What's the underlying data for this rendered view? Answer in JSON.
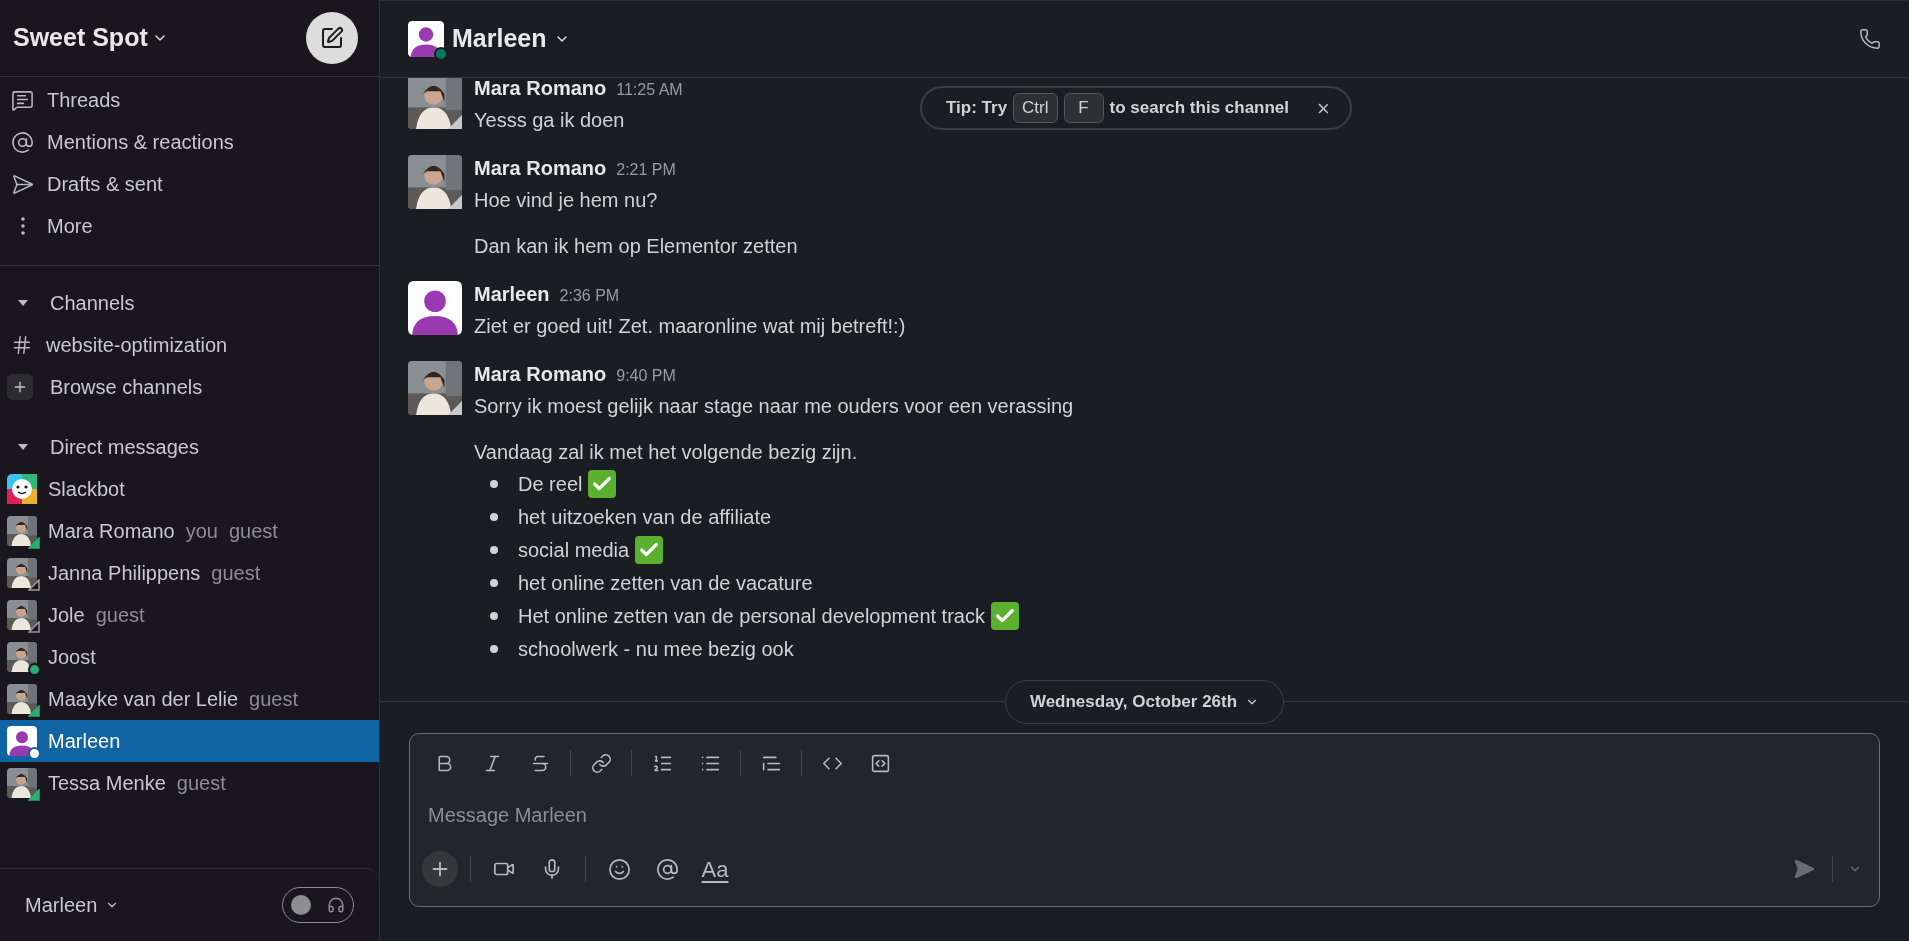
{
  "workspace": {
    "name": "Sweet Spot"
  },
  "nav": [
    {
      "kind": "threads",
      "label": "Threads"
    },
    {
      "kind": "mentions",
      "label": "Mentions & reactions"
    },
    {
      "kind": "drafts",
      "label": "Drafts & sent"
    },
    {
      "kind": "more",
      "label": "More"
    }
  ],
  "channels": {
    "title": "Channels",
    "expanded": true,
    "items": [
      {
        "kind": "channel",
        "label": "website-optimization"
      },
      {
        "kind": "browse",
        "label": "Browse channels"
      }
    ]
  },
  "direct_messages": {
    "title": "Direct messages",
    "expanded": true,
    "items": [
      {
        "name": "Slackbot",
        "kind": "bot",
        "selected": false
      },
      {
        "name": "Mara Romano",
        "tags": [
          "you",
          "guest"
        ],
        "kind": "guest",
        "online": true,
        "selected": false
      },
      {
        "name": "Janna Philippens",
        "tags": [
          "guest"
        ],
        "kind": "guest",
        "online": false,
        "selected": false
      },
      {
        "name": "Jole",
        "tags": [
          "guest"
        ],
        "kind": "guest",
        "online": false,
        "selected": false
      },
      {
        "name": "Joost",
        "kind": "member",
        "online": true,
        "selected": false
      },
      {
        "name": "Maayke van der Lelie",
        "tags": [
          "guest"
        ],
        "kind": "guest",
        "online": true,
        "selected": false
      },
      {
        "name": "Marleen",
        "kind": "default",
        "online": true,
        "selected": true
      },
      {
        "name": "Tessa Menke",
        "tags": [
          "guest"
        ],
        "kind": "guest",
        "online": true,
        "selected": false
      }
    ]
  },
  "footer": {
    "user": "Marleen",
    "huddle_on": false
  },
  "header": {
    "title": "Marleen",
    "online": true
  },
  "tip": {
    "prefix": "Tip: Try",
    "keys": [
      "Ctrl",
      "F"
    ],
    "suffix": "to search this channel",
    "close": "×"
  },
  "messages": [
    {
      "author": "Mara Romano",
      "time": "11:25 AM",
      "lines": [
        "Yesss ga ik doen"
      ]
    },
    {
      "author": "Mara Romano",
      "time": "2:21 PM",
      "lines": [
        "Hoe vind je hem nu?",
        "Dan kan ik hem op Elementor zetten"
      ]
    },
    {
      "author": "Marleen",
      "kind": "default",
      "time": "2:36 PM",
      "lines": [
        "Ziet er goed uit! Zet. maaronline wat mij betreft!:)"
      ]
    },
    {
      "author": "Mara Romano",
      "time": "9:40 PM",
      "lines": [
        "Sorry ik moest gelijk naar stage naar me ouders voor een verassing",
        "Vandaag zal ik met het volgende bezig zijn."
      ],
      "list": [
        {
          "text": "De reel",
          "done": true
        },
        {
          "text": "het uitzoeken van de affiliate",
          "done": false
        },
        {
          "text": "social media",
          "done": true
        },
        {
          "text": "het online zetten van de vacature",
          "done": false
        },
        {
          "text": "Het online zetten van de personal development track",
          "done": true
        },
        {
          "text": "schoolwerk - nu mee bezig ook",
          "done": false
        }
      ]
    }
  ],
  "date_divider": "Wednesday, October 26th",
  "composer": {
    "placeholder": "Message Marleen",
    "format_label": "Aa"
  }
}
